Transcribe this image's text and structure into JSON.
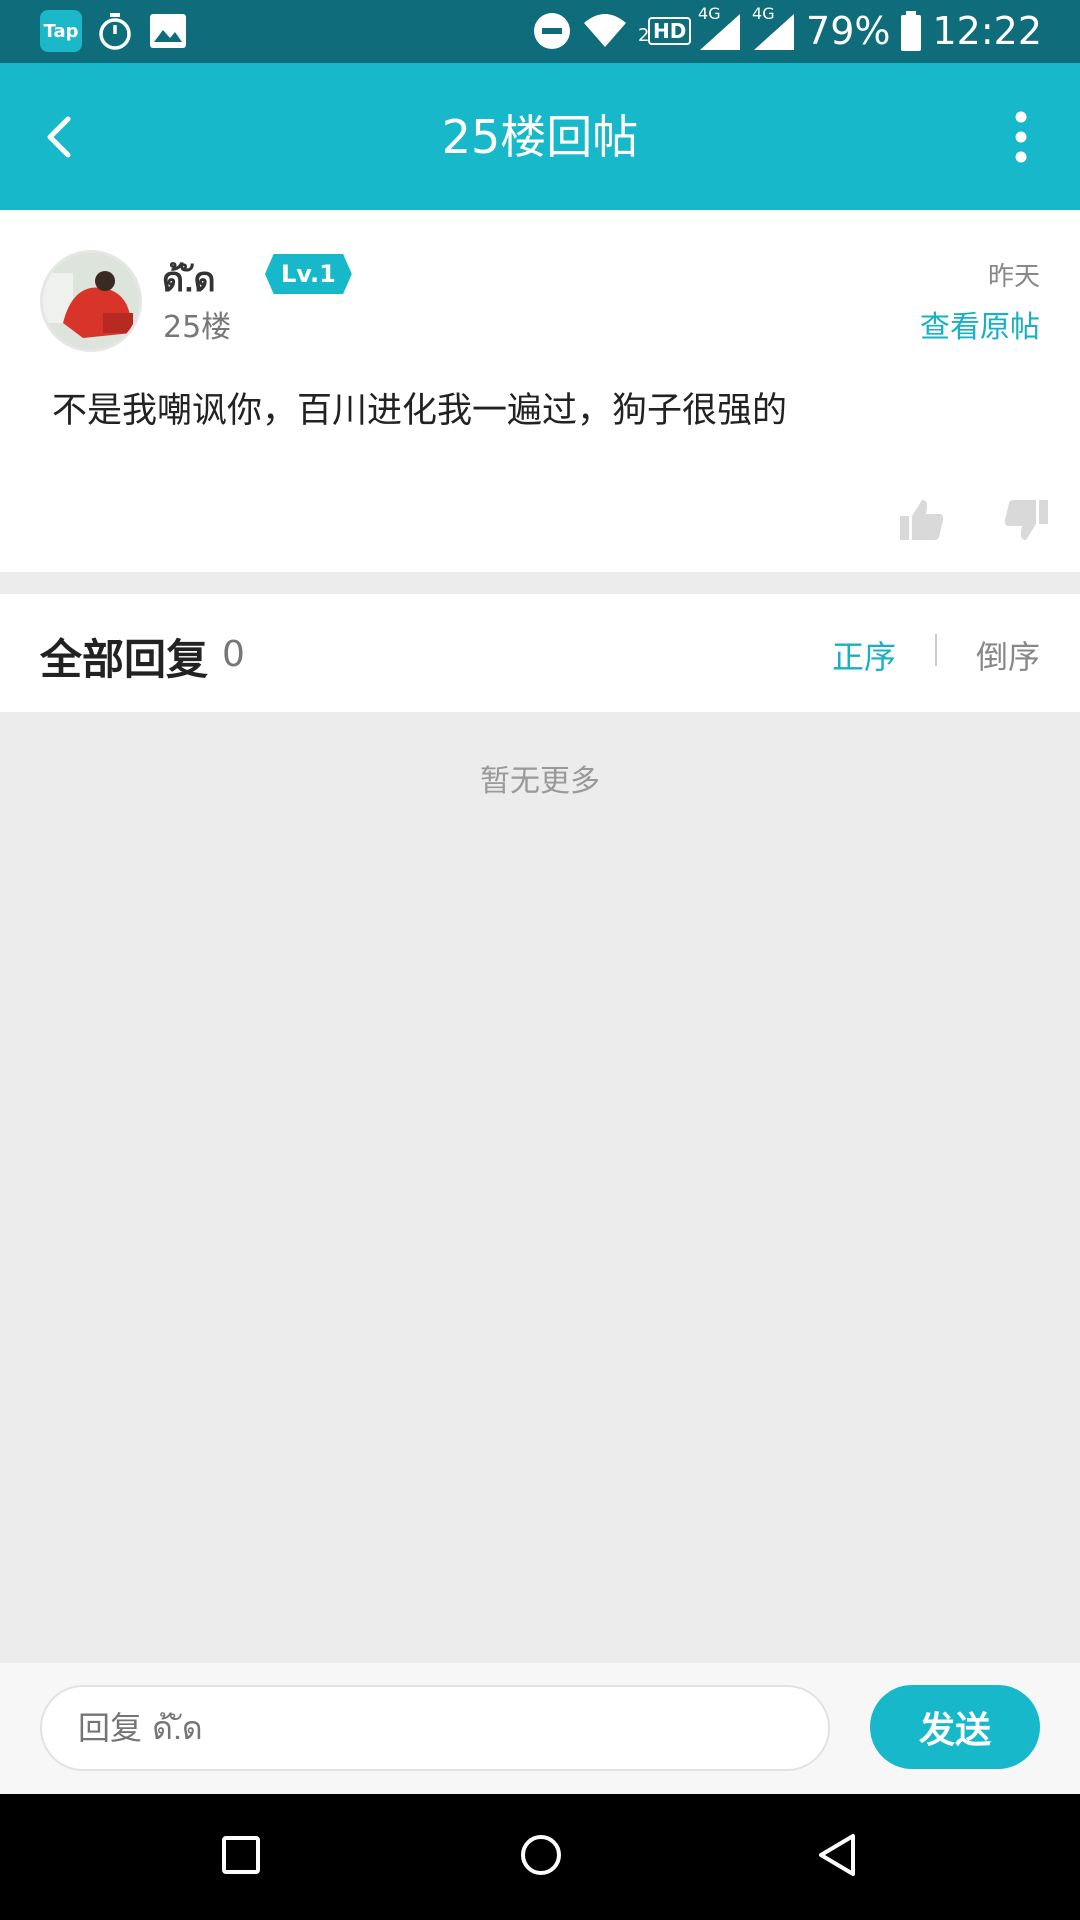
{
  "status_bar": {
    "app_icon_label": "Tap",
    "battery_percent": "79%",
    "time": "12:22",
    "network_label_1": "4G",
    "network_label_2": "4G",
    "sim_label": "2",
    "hd_label": "HD"
  },
  "header": {
    "title": "25楼回帖"
  },
  "post": {
    "username": "ด้.ัด",
    "level": "Lv.1",
    "floor": "25楼",
    "time": "昨天",
    "view_original": "查看原帖",
    "content": "不是我嘲讽你，百川进化我一遍过，狗子很强的"
  },
  "replies": {
    "title": "全部回复",
    "count": "0",
    "sort_asc": "正序",
    "sort_desc": "倒序",
    "empty_text": "暂无更多"
  },
  "compose": {
    "placeholder": "回复 ด้.ัด",
    "send_label": "发送"
  },
  "colors": {
    "accent": "#17b8c9",
    "status_bar": "#0f6c7a"
  }
}
